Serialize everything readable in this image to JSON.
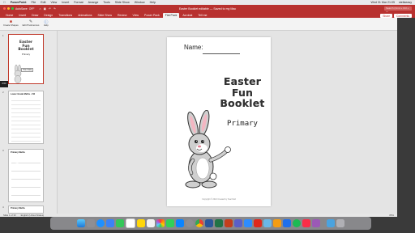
{
  "menubar": {
    "app_name": "PowerPoint",
    "items": [
      "File",
      "Edit",
      "View",
      "Insert",
      "Format",
      "Arrange",
      "Tools",
      "Slide Show",
      "Window",
      "Help"
    ],
    "clock": "Wed 31 Mar 21:05",
    "user": "stellaeasy"
  },
  "titlebar": {
    "autosave_label": "AutoSave",
    "autosave_state": "OFF",
    "doc_title": "Easter Booklet editable — Saved to my Mac",
    "search_placeholder": "Search (Cmd + Ctrl + U)"
  },
  "ribbon_tabs": {
    "tabs": [
      "Home",
      "Insert",
      "Draw",
      "Design",
      "Transitions",
      "Animations",
      "Slide Show",
      "Review",
      "View",
      "Power Pack",
      "Flat Pack",
      "Acrobat",
      "Tell me"
    ],
    "active": "Flat Pack",
    "share_label": "Share",
    "comments_label": "Comments"
  },
  "ribbon": {
    "buttons": [
      {
        "icon": "shapes-icon",
        "label": "Create Shapes"
      },
      {
        "icon": "edit-icon",
        "label": "Edit Preferences"
      },
      {
        "icon": "help-icon",
        "label": "Help"
      }
    ]
  },
  "sidebar": {
    "slides": [
      {
        "number": "1",
        "title_lines": [
          "Easter",
          "Fun",
          "Booklet"
        ],
        "subtitle": "Primary"
      },
      {
        "number": "2",
        "title": "Lower Grade Maths - Fill"
      },
      {
        "number": "3",
        "title": "Primary Maths"
      },
      {
        "number": "4",
        "title": "Primary Maths"
      }
    ],
    "tooltip": "Title Slide",
    "side_tag": "0:00"
  },
  "slide": {
    "name_label": "Name:",
    "title_lines": [
      "Easter",
      "Fun",
      "Booklet"
    ],
    "subtitle": "Primary",
    "copyright": "Copyright © 2021 Created by Teach Ed"
  },
  "statusbar": {
    "slide_info": "Slide 1 of 33",
    "language": "English (United States)",
    "notes": "Notes",
    "comments": "Comments",
    "zoom": "85%"
  },
  "colors": {
    "accent": "#b8312f",
    "ribbon_bg": "#f3f3f3",
    "canvas_bg": "#e4e4e4"
  },
  "dock": {
    "icons": [
      "finder-icon",
      "launchpad-icon",
      "safari-icon",
      "mail-icon",
      "messages-icon",
      "calendar-icon",
      "notes-icon",
      "reminders-icon",
      "photos-icon",
      "facetime-icon",
      "appstore-icon",
      "settings-icon",
      "chrome-icon",
      "word-icon",
      "excel-icon",
      "powerpoint-icon",
      "teams-icon",
      "zoom-icon",
      "acrobat-icon",
      "preview-icon",
      "pages-icon",
      "keynote-icon",
      "spotify-icon",
      "music-icon",
      "podcasts-icon",
      "downloads-icon",
      "trash-icon"
    ]
  }
}
